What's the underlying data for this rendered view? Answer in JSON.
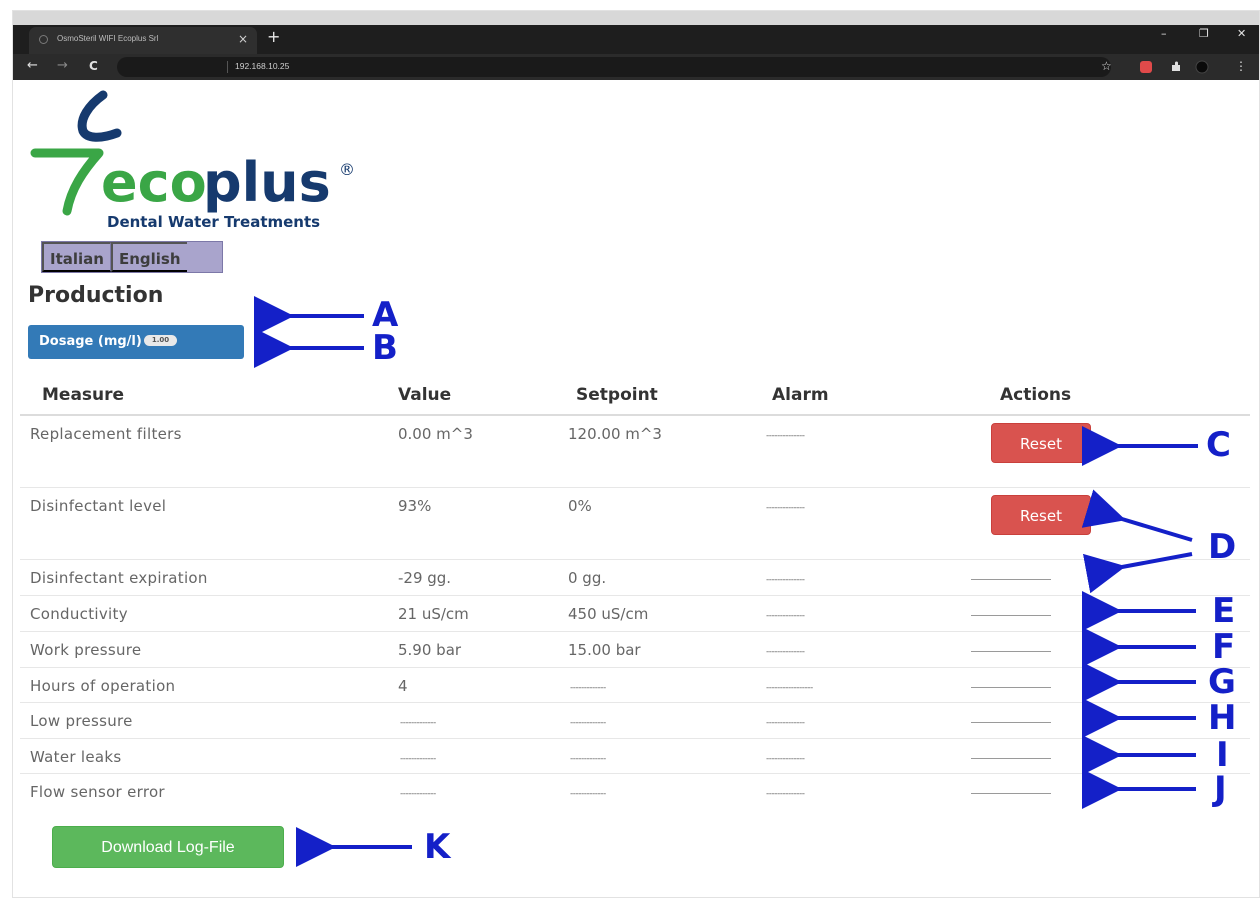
{
  "browser": {
    "tab_title": "OsmoSteril WIFI Ecoplus Srl",
    "tab_close": "×",
    "new_tab": "+",
    "url": "192.168.10.25",
    "back": "←",
    "forward": "→",
    "reload": "C",
    "minimize": "–",
    "maximize": "❐",
    "close": "✕",
    "star": "☆",
    "menu": "⋮"
  },
  "logo": {
    "brand_eco": "eco",
    "brand_plus": "plus",
    "registered": "®",
    "tagline": "Dental Water Treatments",
    "colors": {
      "green": "#3aa646",
      "navy": "#163a6e"
    }
  },
  "language": {
    "italian": "Italian",
    "english": "English"
  },
  "page": {
    "heading": "Production",
    "dosage_label": "Dosage (mg/l)",
    "dosage_badge": "1.00"
  },
  "table": {
    "headers": [
      "Measure",
      "Value",
      "Setpoint",
      "Alarm",
      "Actions"
    ],
    "rows": [
      {
        "measure": "Replacement filters",
        "value": "0.00 m^3",
        "setpoint": "120.00 m^3",
        "alarm": "--------------",
        "action": "Reset"
      },
      {
        "measure": "Disinfectant level",
        "value": "93%",
        "setpoint": "0%",
        "alarm": "--------------",
        "action": "Reset"
      },
      {
        "measure": "Disinfectant expiration",
        "value": "-29 gg.",
        "setpoint": "0 gg.",
        "alarm": "--------------",
        "action": ""
      },
      {
        "measure": "Conductivity",
        "value": "21 uS/cm",
        "setpoint": "450 uS/cm",
        "alarm": "--------------",
        "action": ""
      },
      {
        "measure": "Work pressure",
        "value": "5.90 bar",
        "setpoint": "15.00 bar",
        "alarm": "--------------",
        "action": ""
      },
      {
        "measure": "Hours of operation",
        "value": "4",
        "setpoint": "-------------",
        "alarm": "-----------------",
        "action": ""
      },
      {
        "measure": "Low pressure",
        "value": "-------------",
        "setpoint": "-------------",
        "alarm": "--------------",
        "action": ""
      },
      {
        "measure": "Water leaks",
        "value": "-------------",
        "setpoint": "-------------",
        "alarm": "--------------",
        "action": ""
      },
      {
        "measure": "Flow sensor error",
        "value": "-------------",
        "setpoint": "-------------",
        "alarm": "--------------",
        "action": ""
      }
    ]
  },
  "download_label": "Download Log-File",
  "callouts": {
    "A": "A",
    "B": "B",
    "C": "C",
    "D": "D",
    "E": "E",
    "F": "F",
    "G": "G",
    "H": "H",
    "I": "I",
    "J": "J",
    "K": "K",
    "color": "#1420c8"
  },
  "colors": {
    "reset_button": "#d9534f",
    "dosage_button": "#337ab7",
    "download_button": "#5cb85c",
    "language_bar": "#a9a4cc"
  }
}
